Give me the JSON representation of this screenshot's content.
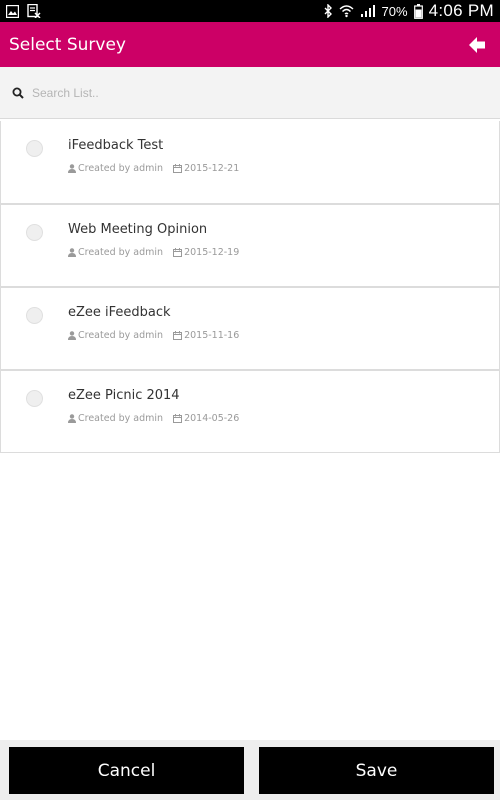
{
  "status_bar": {
    "battery": "70%",
    "time": "4:06 PM",
    "icons": [
      "image-icon",
      "document-x-icon",
      "bluetooth-icon",
      "wifi-icon",
      "signal-icon",
      "battery-icon"
    ]
  },
  "app_bar": {
    "title": "Select Survey",
    "color": "#cc0066",
    "back_icon": "arrow-left-icon"
  },
  "search": {
    "placeholder": "Search List..",
    "value": "",
    "icon": "search-icon"
  },
  "surveys": [
    {
      "title": "iFeedback Test",
      "created_by": "Created by admin",
      "date": "2015-12-21"
    },
    {
      "title": "Web Meeting Opinion",
      "created_by": "Created by admin",
      "date": "2015-12-19"
    },
    {
      "title": "eZee iFeedback",
      "created_by": "Created by admin",
      "date": "2015-11-16"
    },
    {
      "title": "eZee Picnic 2014",
      "created_by": "Created by admin",
      "date": "2014-05-26"
    }
  ],
  "actions": {
    "cancel_label": "Cancel",
    "save_label": "Save"
  }
}
